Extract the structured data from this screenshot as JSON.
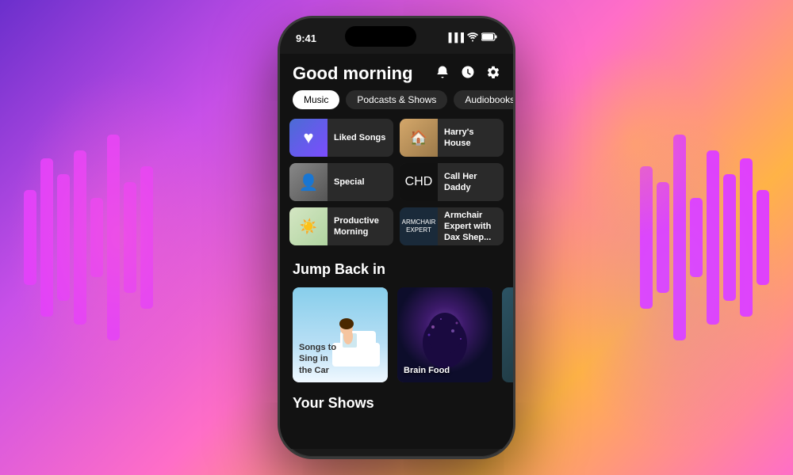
{
  "background": {
    "gradient_start": "#6b2fcc",
    "gradient_end": "#ff6ec7"
  },
  "status_bar": {
    "time": "9:41",
    "signal": "▌▌▌",
    "wifi": "WiFi",
    "battery": "Battery"
  },
  "header": {
    "greeting": "Good morning",
    "bell_icon": "bell",
    "timer_icon": "timer",
    "settings_icon": "gear"
  },
  "filter_tabs": [
    {
      "label": "Music",
      "active": true
    },
    {
      "label": "Podcasts & Shows",
      "active": false
    },
    {
      "label": "Audiobooks",
      "active": false
    }
  ],
  "shortcuts": [
    {
      "id": "liked-songs",
      "label": "Liked Songs",
      "type": "liked"
    },
    {
      "id": "harrys-house",
      "label": "Harry's House",
      "type": "harrys"
    },
    {
      "id": "special",
      "label": "Special",
      "type": "special"
    },
    {
      "id": "call-her-daddy",
      "label": "Call Her Daddy",
      "type": "calher"
    },
    {
      "id": "productive-morning",
      "label": "Productive Morning",
      "type": "productive"
    },
    {
      "id": "armchair-expert",
      "label": "Armchair Expert with Dax Shep...",
      "type": "armchair"
    }
  ],
  "jump_back_section": {
    "heading": "Jump Back in"
  },
  "jump_back_cards": [
    {
      "id": "songs-car",
      "title": "Songs to Sing in the Car",
      "type": "songs-car"
    },
    {
      "id": "brain-food",
      "title": "Brain Food",
      "type": "brain-food"
    }
  ],
  "your_shows_section": {
    "heading": "Your Shows"
  }
}
